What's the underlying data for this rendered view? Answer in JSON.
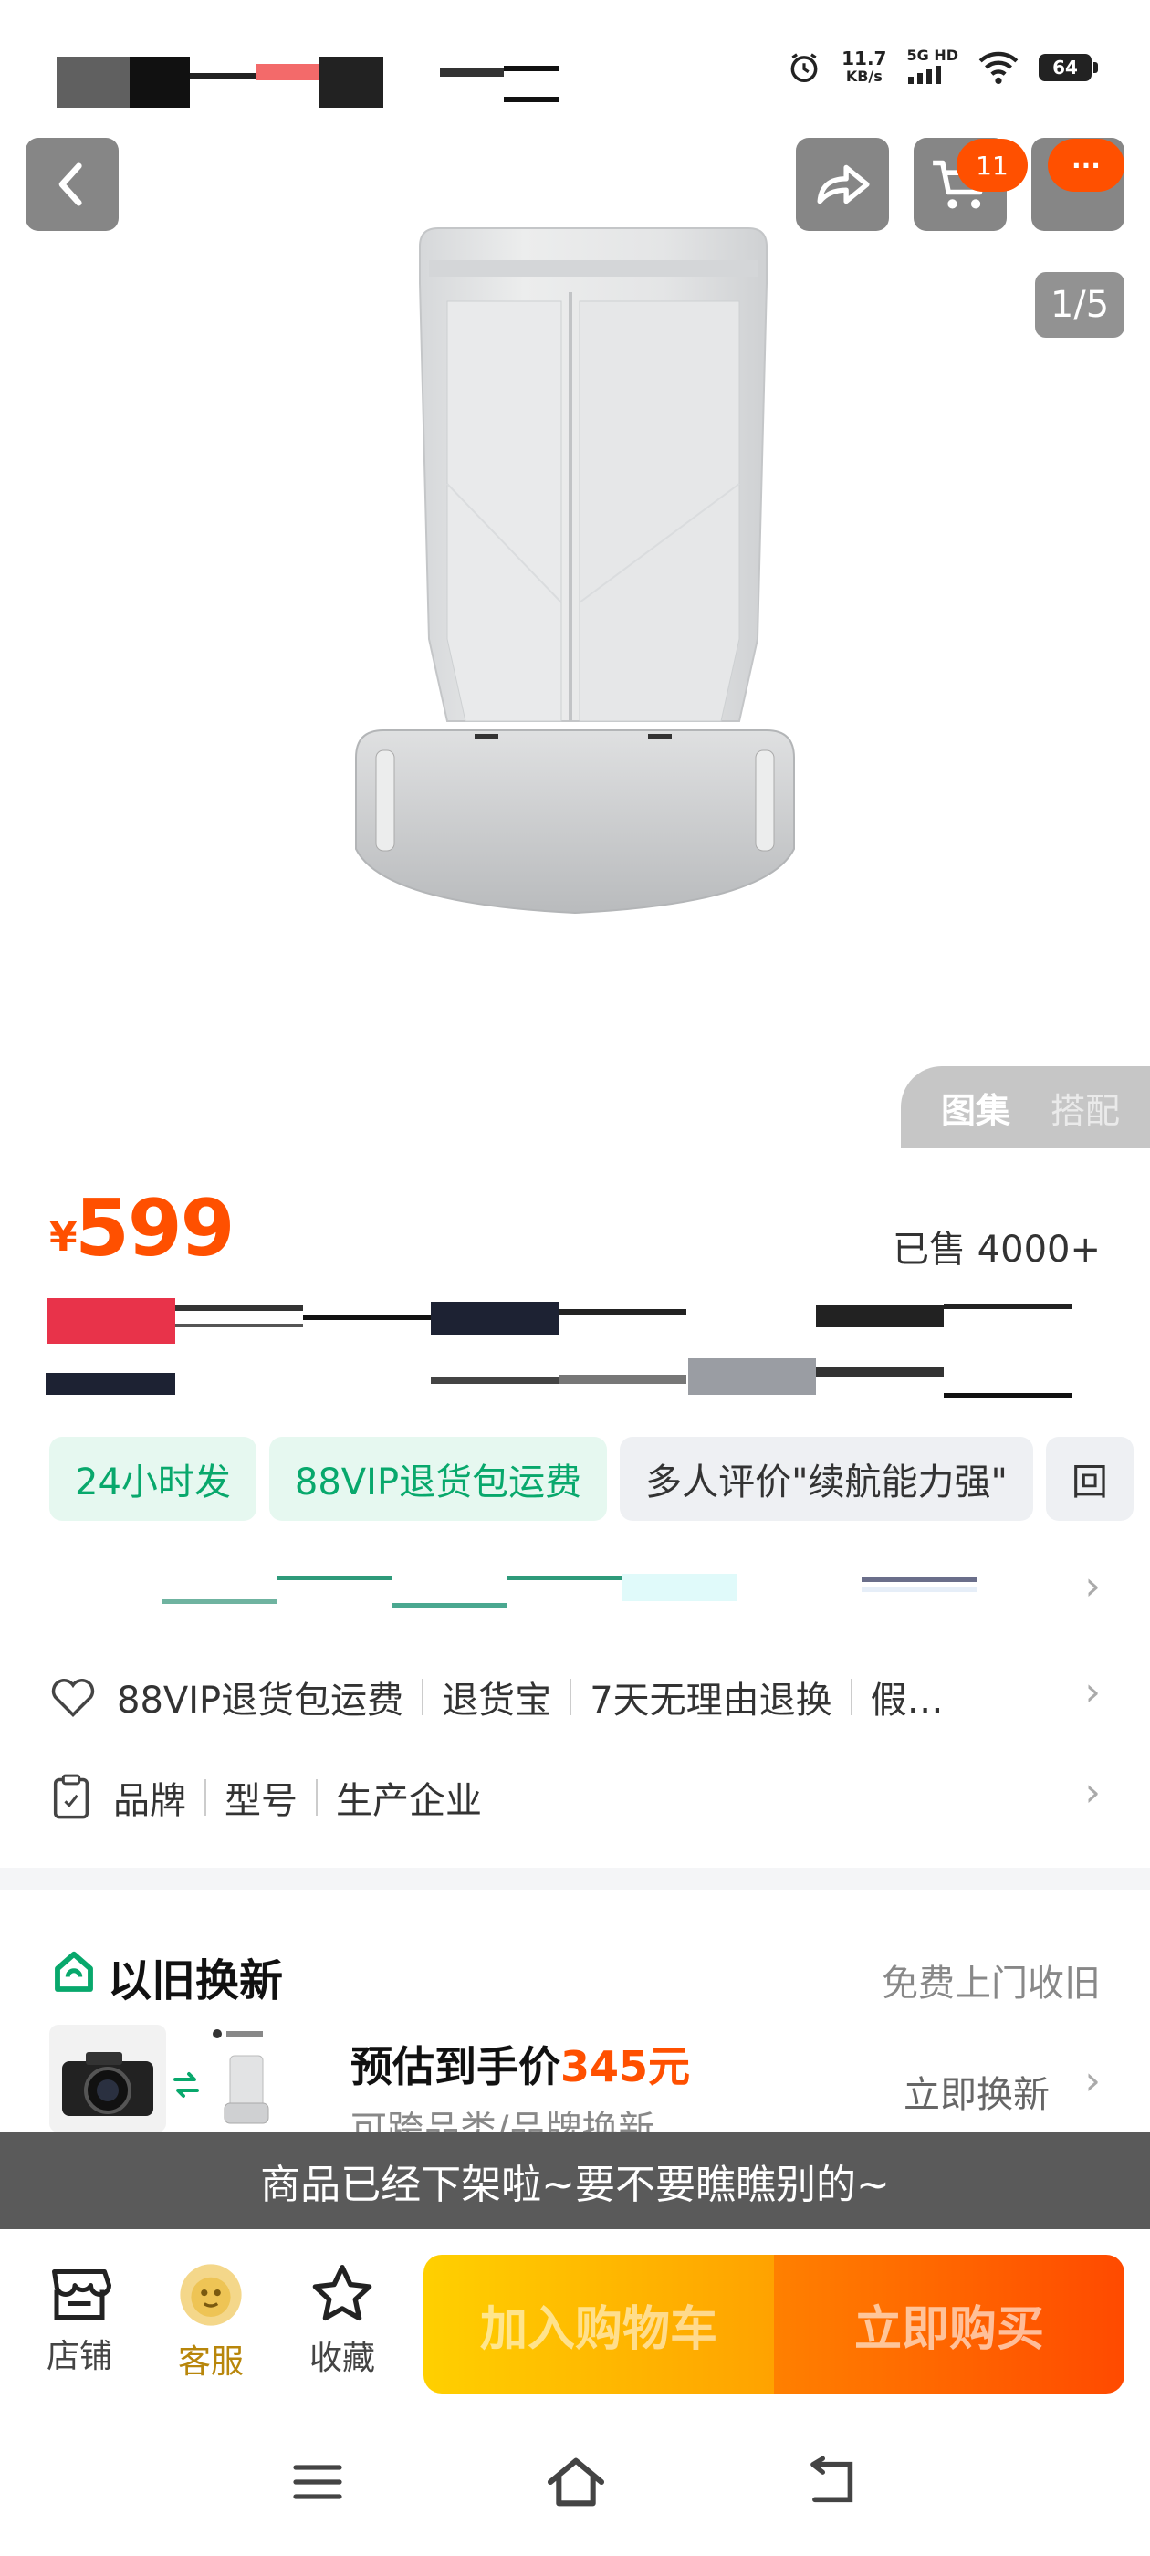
{
  "status_bar": {
    "net_speed": "11.7",
    "net_unit": "KB/s",
    "signal_label": "5G HD",
    "battery": "64"
  },
  "header": {
    "cart_badge": "11",
    "more_badge": "···"
  },
  "gallery": {
    "page_indicator": "1/5",
    "tab_active": "图集",
    "tab_inactive": "搭配"
  },
  "price": {
    "currency": "¥",
    "value": "599",
    "sold": "已售 4000+"
  },
  "tags": [
    "24小时发",
    "88VIP退货包运费",
    "多人评价\"续航能力强\"",
    "回"
  ],
  "services": {
    "items": [
      "88VIP退货包运费",
      "退货宝",
      "7天无理由退换",
      "假…"
    ]
  },
  "params": {
    "items": [
      "品牌",
      "型号",
      "生产企业"
    ]
  },
  "trade_in": {
    "title": "以旧换新",
    "free": "免费上门收旧",
    "price_prefix": "预估到手价",
    "price_value": "345元",
    "subtitle": "可跨品类/品牌换新",
    "cta": "立即换新"
  },
  "toast": "商品已经下架啦~要不要瞧瞧别的~",
  "bottom_bar": {
    "shop": "店铺",
    "service": "客服",
    "favorite": "收藏",
    "add_cart": "加入购物车",
    "buy_now": "立即购买"
  },
  "colors": {
    "accent": "#ff5000",
    "green": "#08a86c"
  }
}
